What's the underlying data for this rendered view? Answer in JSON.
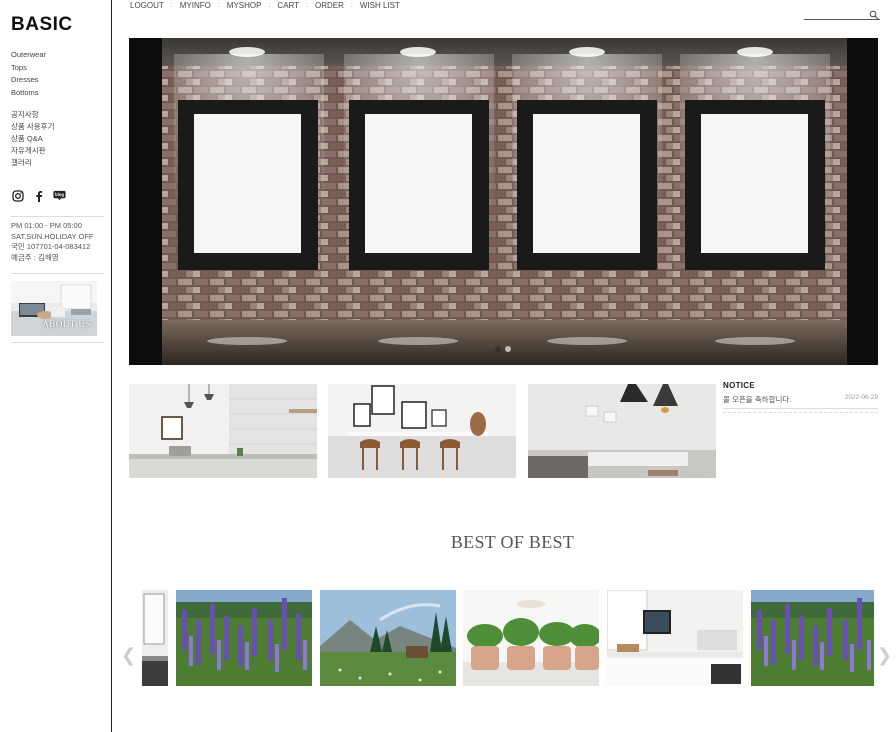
{
  "brand": {
    "logo": "BASIC"
  },
  "sidebar": {
    "categories": [
      {
        "label": "Outerwear"
      },
      {
        "label": "Tops"
      },
      {
        "label": "Dresses"
      },
      {
        "label": "Bottoms"
      }
    ],
    "boards": [
      {
        "label": "공지사항"
      },
      {
        "label": "상품 사용후기"
      },
      {
        "label": "상품 Q&A"
      },
      {
        "label": "자유게시판"
      },
      {
        "label": "갤러리"
      }
    ],
    "social": [
      {
        "icon": "instagram-icon",
        "glyph": "◎"
      },
      {
        "icon": "facebook-icon",
        "glyph": "f"
      },
      {
        "icon": "blog-icon",
        "glyph": "blog"
      }
    ],
    "info": {
      "hours": "PM 01:00 - PM 05:00",
      "holiday": "SAT.SUN.HOLIDAY OFF",
      "bank": "국민 107701-04-083412",
      "holder": "예금주 : 김해영"
    },
    "about_label": "ABOUT US"
  },
  "topnav": {
    "items": [
      {
        "label": "LOGOUT"
      },
      {
        "label": "MYINFO"
      },
      {
        "label": "MYSHOP"
      },
      {
        "label": "CART"
      },
      {
        "label": "ORDER"
      },
      {
        "label": "WISH LIST"
      }
    ],
    "separator": ":"
  },
  "search": {
    "placeholder": "",
    "icon": "search-icon"
  },
  "hero": {
    "slides": 2,
    "active": 1
  },
  "notice": {
    "title": "NOTICE",
    "items": [
      {
        "text": "몰 오픈을 축하합니다.",
        "date": "2022-06-29"
      }
    ]
  },
  "best": {
    "title": "BEST OF BEST",
    "prev": "❮",
    "next": "❯"
  },
  "colors": {
    "accent": "#222222",
    "muted": "#999999"
  }
}
